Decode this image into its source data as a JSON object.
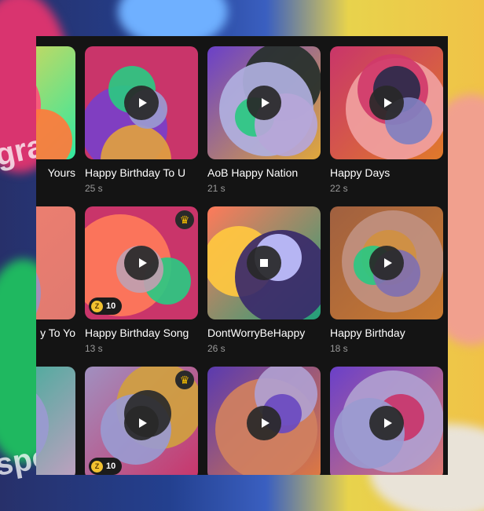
{
  "background": {
    "texts": [
      "gra",
      "spo"
    ]
  },
  "rows": [
    [
      {
        "title": "Yours",
        "duration": "",
        "premium": false,
        "coins": "",
        "playing": false
      },
      {
        "title": "Happy Birthday To U",
        "duration": "25 s",
        "premium": false,
        "coins": "",
        "playing": false
      },
      {
        "title": "AoB Happy Nation",
        "duration": "21 s",
        "premium": false,
        "coins": "",
        "playing": false
      },
      {
        "title": "Happy Days",
        "duration": "22 s",
        "premium": false,
        "coins": "",
        "playing": false
      }
    ],
    [
      {
        "title": "y To Yo",
        "duration": "",
        "premium": false,
        "coins": "",
        "playing": false
      },
      {
        "title": "Happy Birthday Song",
        "duration": "13 s",
        "premium": true,
        "coins": "10",
        "playing": false
      },
      {
        "title": "DontWorryBeHappy",
        "duration": "26 s",
        "premium": false,
        "coins": "",
        "playing": true
      },
      {
        "title": "Happy Birthday",
        "duration": "18 s",
        "premium": false,
        "coins": "",
        "playing": false
      }
    ],
    [
      {
        "title": "",
        "duration": "",
        "premium": false,
        "coins": "",
        "playing": false
      },
      {
        "title": "",
        "duration": "",
        "premium": true,
        "coins": "10",
        "playing": false
      },
      {
        "title": "",
        "duration": "",
        "premium": false,
        "coins": "",
        "playing": false
      },
      {
        "title": "",
        "duration": "",
        "premium": false,
        "coins": "",
        "playing": false
      }
    ]
  ],
  "icons": {
    "play": "play-icon",
    "stop": "stop-icon",
    "crown": "crown-icon",
    "coin": "coin-icon",
    "coin_glyph": "Z",
    "crown_glyph": "♛"
  },
  "colors": {
    "panel": "#141414",
    "title": "#ffffff",
    "duration": "#9a9a9a",
    "crown": "#f0b800",
    "coin": "#f2c230"
  }
}
